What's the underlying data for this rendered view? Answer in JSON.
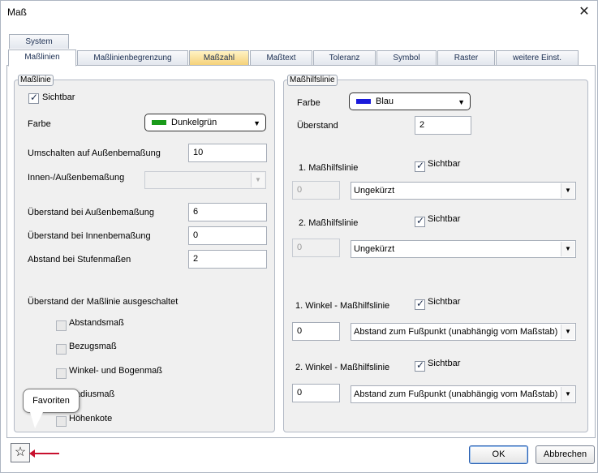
{
  "window": {
    "title": "Maß",
    "close_glyph": "✕"
  },
  "top_tab": "System",
  "tabs": [
    "Maßlinien",
    "Maßlinienbegrenzung",
    "Maßzahl",
    "Maßtext",
    "Toleranz",
    "Symbol",
    "Raster",
    "weitere Einst."
  ],
  "left": {
    "legend": "Maßlinie",
    "sichtbar_label": "Sichtbar",
    "farbe_label": "Farbe",
    "farbe_value": "Dunkelgrün",
    "farbe_hex": "#1a9a1a",
    "umschalten_label": "Umschalten auf Außenbemaßung",
    "umschalten_value": "10",
    "innen_aussen_label": "Innen-/Außenbemaßung",
    "ueberstand_aussen_label": "Überstand bei Außenbemaßung",
    "ueberstand_aussen_value": "6",
    "ueberstand_innen_label": "Überstand bei Innenbemaßung",
    "ueberstand_innen_value": "0",
    "abstand_label": "Abstand bei Stufenmaßen",
    "abstand_value": "2",
    "ausgeschaltet_label": "Überstand der Maßlinie ausgeschaltet",
    "checkboxes": [
      "Abstandsmaß",
      "Bezugsmaß",
      "Winkel- und Bogenmaß",
      "Radiusmaß",
      "Höhenkote"
    ]
  },
  "right": {
    "legend": "Maßhilfslinie",
    "farbe_label": "Farbe",
    "farbe_value": "Blau",
    "farbe_hex": "#1a1adb",
    "ueberstand_label": "Überstand",
    "ueberstand_value": "2",
    "hilfs1_label": "1. Maßhilfslinie",
    "hilfs1_sichtbar": "Sichtbar",
    "hilfs1_value": "0",
    "hilfs1_select": "Ungekürzt",
    "hilfs2_label": "2. Maßhilfslinie",
    "hilfs2_sichtbar": "Sichtbar",
    "hilfs2_value": "0",
    "hilfs2_select": "Ungekürzt",
    "winkel1_label": "1. Winkel - Maßhilfslinie",
    "winkel1_sichtbar": "Sichtbar",
    "winkel1_value": "0",
    "winkel1_select": "Abstand zum Fußpunkt (unabhängig vom Maßstab)",
    "winkel2_label": "2. Winkel - Maßhilfslinie",
    "winkel2_sichtbar": "Sichtbar",
    "winkel2_value": "0",
    "winkel2_select": "Abstand zum Fußpunkt (unabhängig vom Maßstab)"
  },
  "tooltip": "Favoriten",
  "star_glyph": "☆",
  "buttons": {
    "ok": "OK",
    "cancel": "Abbrechen"
  }
}
